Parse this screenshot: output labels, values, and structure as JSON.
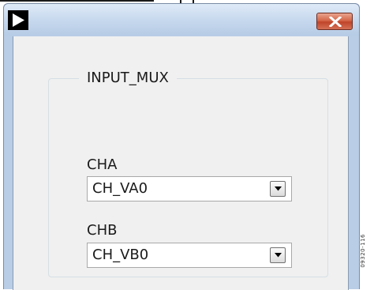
{
  "window": {
    "app_icon": "play-arrow-icon",
    "close_icon": "close-x-icon"
  },
  "group": {
    "title": "INPUT_MUX"
  },
  "fields": [
    {
      "label": "CHA",
      "value": "CH_VA0"
    },
    {
      "label": "CHB",
      "value": "CH_VB0"
    }
  ],
  "dropdown_icon": "chevron-down-icon",
  "figure_code": "09320-116",
  "colors": {
    "titlebar": "#c7d9ee",
    "close_button": "#c9553a",
    "client_background": "#f0f0f0"
  }
}
